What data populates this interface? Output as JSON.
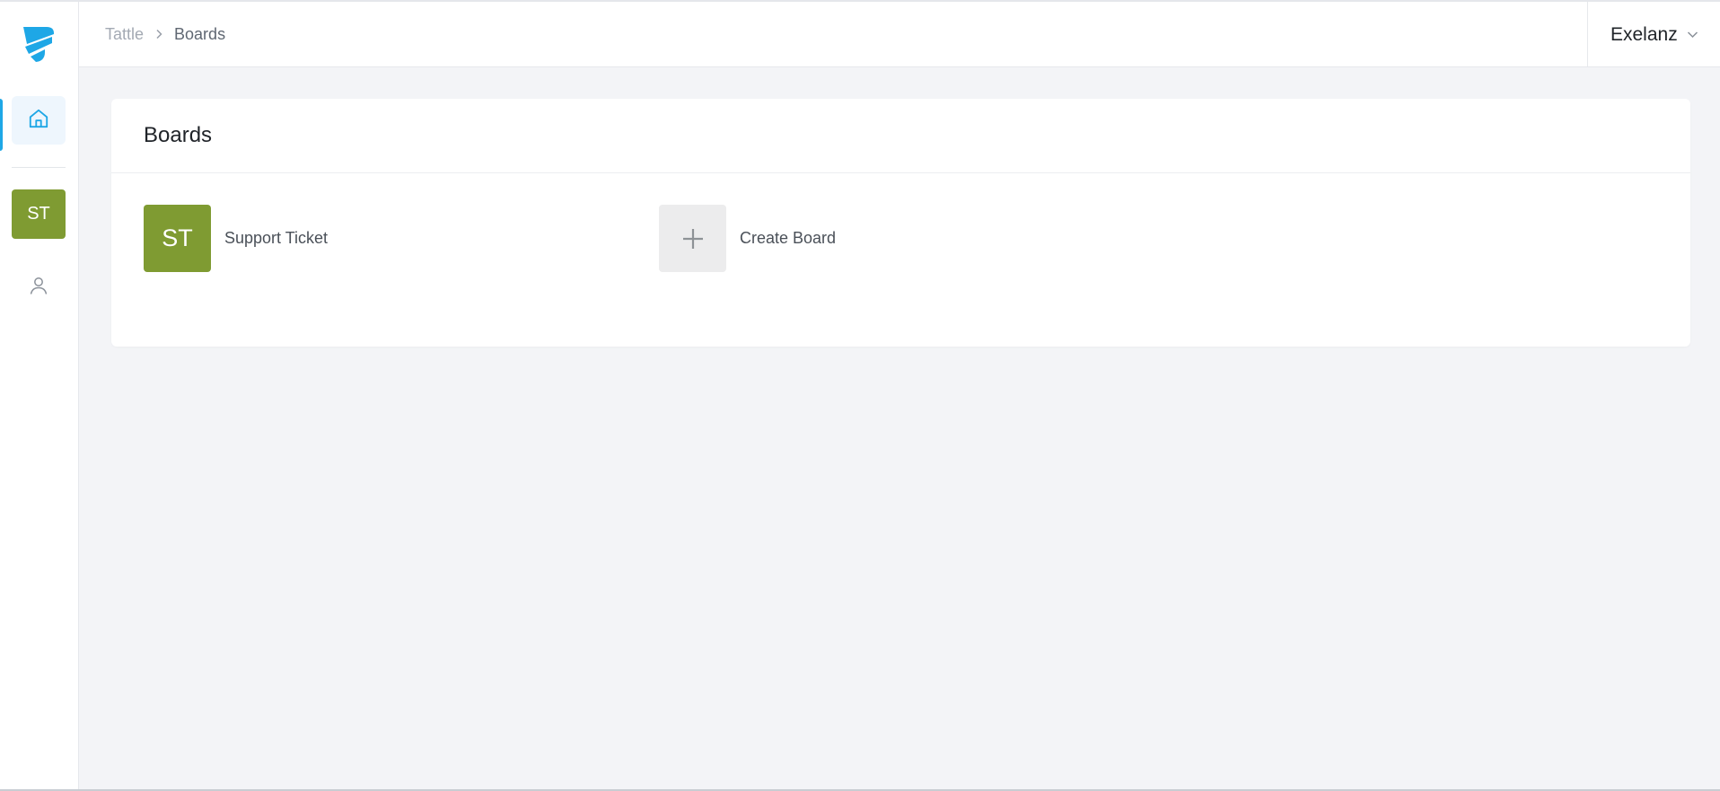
{
  "app": {
    "brand_color": "#1ea7e6"
  },
  "sidebar": {
    "logo_icon": "tattle-logo-icon",
    "home_icon": "home-icon",
    "board_badge": "ST",
    "board_badge_color": "#7f9b32",
    "user_icon": "user-icon"
  },
  "header": {
    "breadcrumb": {
      "root": "Tattle",
      "current": "Boards"
    },
    "org": {
      "name": "Exelanz"
    }
  },
  "boards_card": {
    "title": "Boards",
    "items": [
      {
        "initials": "ST",
        "label": "Support Ticket",
        "color": "#7f9b32"
      }
    ],
    "create": {
      "label": "Create Board",
      "icon": "plus-icon"
    }
  }
}
